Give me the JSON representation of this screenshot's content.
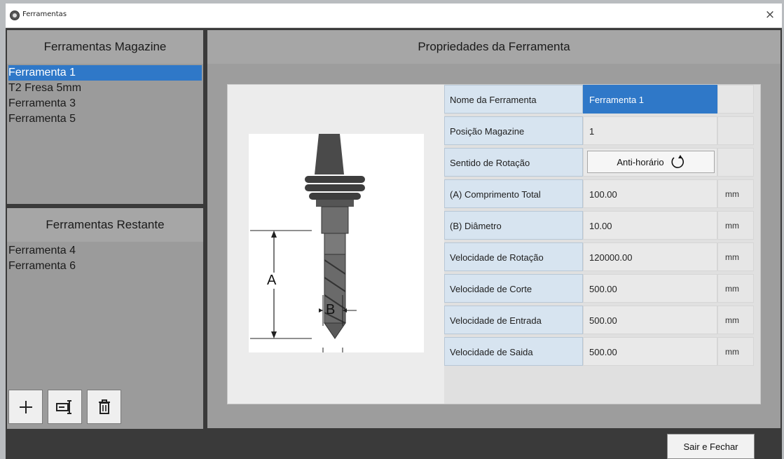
{
  "window": {
    "title": "Ferramentas",
    "close_symbol": "×"
  },
  "magazine": {
    "header": "Ferramentas Magazine",
    "items": [
      "Ferramenta 1",
      "T2 Fresa 5mm",
      "Ferramenta 3",
      "Ferramenta 5"
    ],
    "selected_index": 0
  },
  "restante": {
    "header": "Ferramentas Restante",
    "items": [
      "Ferramenta 4",
      "Ferramenta 6"
    ]
  },
  "toolbar": {
    "add_icon": "plus-icon",
    "rename_icon": "rename-icon",
    "delete_icon": "trash-icon"
  },
  "properties": {
    "header": "Propriedades da Ferramenta",
    "diagram": {
      "label_a": "A",
      "label_b": "B"
    },
    "rows": [
      {
        "label": "Nome da Ferramenta",
        "value": "Ferramenta 1",
        "unit": ""
      },
      {
        "label": "Posição Magazine",
        "value": "1",
        "unit": ""
      },
      {
        "label": "Sentido de Rotação",
        "value": "Anti-horário",
        "unit": ""
      },
      {
        "label": "(A) Comprimento Total",
        "value": "100.00",
        "unit": "mm"
      },
      {
        "label": "(B) Diâmetro",
        "value": "10.00",
        "unit": "mm"
      },
      {
        "label": "Velocidade de Rotação",
        "value": "120000.00",
        "unit": "mm"
      },
      {
        "label": "Velocidade de Corte",
        "value": "500.00",
        "unit": "mm"
      },
      {
        "label": "Velocidade de Entrada",
        "value": "500.00",
        "unit": "mm"
      },
      {
        "label": "Velocidade de Saida",
        "value": "500.00",
        "unit": "mm"
      }
    ]
  },
  "footer": {
    "exit_label": "Sair e Fechar"
  },
  "colors": {
    "selection": "#2f78c8",
    "label_cell": "#d7e4f0"
  }
}
